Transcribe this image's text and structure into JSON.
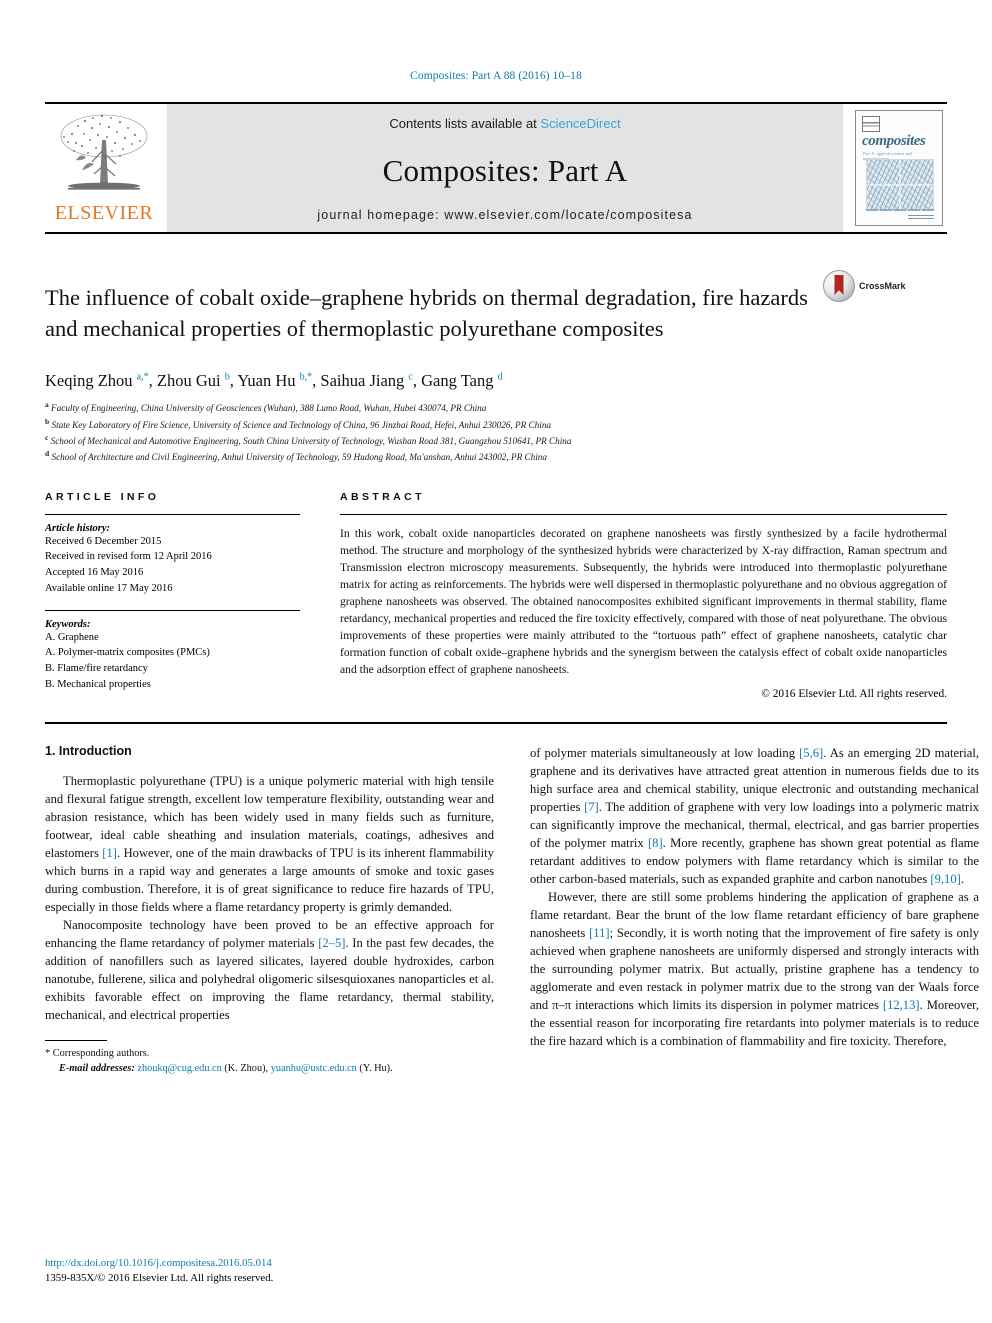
{
  "running_head": "Composites: Part A 88 (2016) 10–18",
  "masthead": {
    "publisher": "ELSEVIER",
    "contents_prefix": "Contents lists available at ",
    "contents_link": "ScienceDirect",
    "journal_name": "Composites: Part A",
    "homepage": "journal homepage: www.elsevier.com/locate/compositesa",
    "cover": {
      "title": "composites",
      "subtitle": "Part A: applied science and manufacturing"
    }
  },
  "article": {
    "title": "The influence of cobalt oxide–graphene hybrids on thermal degradation, fire hazards and mechanical properties of thermoplastic polyurethane composites",
    "crossmark_label": "CrossMark",
    "authors_html": "Keqing Zhou <sup>a,*</sup>, Zhou Gui <sup>b</sup>, Yuan Hu <sup>b,*</sup>, Saihua Jiang <sup>c</sup>, Gang Tang <sup>d</sup>",
    "affiliations": [
      {
        "marker": "a",
        "text": "Faculty of Engineering, China University of Geosciences (Wuhan), 388 Lumo Road, Wuhan, Hubei 430074, PR China"
      },
      {
        "marker": "b",
        "text": "State Key Laboratory of Fire Science, University of Science and Technology of China, 96 Jinzhai Road, Hefei, Anhui 230026, PR China"
      },
      {
        "marker": "c",
        "text": "School of Mechanical and Automotive Engineering, South China University of Technology, Wushan Road 381, Guangzhou 510641, PR China"
      },
      {
        "marker": "d",
        "text": "School of Architecture and Civil Engineering, Anhui University of Technology, 59 Hudong Road, Ma'anshan, Anhui 243002, PR China"
      }
    ]
  },
  "article_info": {
    "heading": "ARTICLE INFO",
    "history_title": "Article history:",
    "history": [
      "Received 6 December 2015",
      "Received in revised form 12 April 2016",
      "Accepted 16 May 2016",
      "Available online 17 May 2016"
    ],
    "keywords_title": "Keywords:",
    "keywords": [
      "A. Graphene",
      "A. Polymer-matrix composites (PMCs)",
      "B. Flame/fire retardancy",
      "B. Mechanical properties"
    ]
  },
  "abstract": {
    "heading": "ABSTRACT",
    "text": "In this work, cobalt oxide nanoparticles decorated on graphene nanosheets was firstly synthesized by a facile hydrothermal method. The structure and morphology of the synthesized hybrids were characterized by X-ray diffraction, Raman spectrum and Transmission electron microscopy measurements. Subsequently, the hybrids were introduced into thermoplastic polyurethane matrix for acting as reinforcements. The hybrids were well dispersed in thermoplastic polyurethane and no obvious aggregation of graphene nanosheets was observed. The obtained nanocomposites exhibited significant improvements in thermal stability, flame retardancy, mechanical properties and reduced the fire toxicity effectively, compared with those of neat polyurethane. The obvious improvements of these properties were mainly attributed to the “tortuous path” effect of graphene nanosheets, catalytic char formation function of cobalt oxide–graphene hybrids and the synergism between the catalysis effect of cobalt oxide nanoparticles and the adsorption effect of graphene nanosheets.",
    "copyright": "© 2016 Elsevier Ltd. All rights reserved."
  },
  "introduction": {
    "heading": "1. Introduction",
    "left_paragraphs_html": [
      "Thermoplastic polyurethane (TPU) is a unique polymeric material with high tensile and flexural fatigue strength, excellent low temperature flexibility, outstanding wear and abrasion resistance, which has been widely used in many fields such as furniture, footwear, ideal cable sheathing and insulation materials, coatings, adhesives and elastomers <span class=\"ref\">[1]</span>. However, one of the main drawbacks of TPU is its inherent flammability which burns in a rapid way and generates a large amounts of smoke and toxic gases during combustion. Therefore, it is of great significance to reduce fire hazards of TPU, especially in those fields where a flame retardancy property is grimly demanded.",
      "Nanocomposite technology have been proved to be an effective approach for enhancing the flame retardancy of polymer materials <span class=\"ref\">[2–5]</span>. In the past few decades, the addition of nanofillers such as layered silicates, layered double hydroxides, carbon nanotube, fullerene, silica and polyhedral oligomeric silsesquioxanes nanoparticles et al. exhibits favorable effect on improving the flame retardancy, thermal stability, mechanical, and electrical properties"
    ],
    "right_paragraphs_html": [
      "of polymer materials simultaneously at low loading <span class=\"ref\">[5,6]</span>. As an emerging 2D material, graphene and its derivatives have attracted great attention in numerous fields due to its high surface area and chemical stability, unique electronic and outstanding mechanical properties <span class=\"ref\">[7]</span>. The addition of graphene with very low loadings into a polymeric matrix can significantly improve the mechanical, thermal, electrical, and gas barrier properties of the polymer matrix <span class=\"ref\">[8]</span>. More recently, graphene has shown great potential as flame retardant additives to endow polymers with flame retardancy which is similar to the other carbon-based materials, such as expanded graphite and carbon nanotubes <span class=\"ref\">[9,10]</span>.",
      "However, there are still some problems hindering the application of graphene as a flame retardant. Bear the brunt of the low flame retardant efficiency of bare graphene nanosheets <span class=\"ref\">[11]</span>; Secondly, it is worth noting that the improvement of fire safety is only achieved when graphene nanosheets are uniformly dispersed and strongly interacts with the surrounding polymer matrix. But actually, pristine graphene has a tendency to agglomerate and even restack in polymer matrix due to the strong van der Waals force and π–π interactions which limits its dispersion in polymer matrices <span class=\"ref\">[12,13]</span>. Moreover, the essential reason for incorporating fire retardants into polymer materials is to reduce the fire hazard which is a combination of flammability and fire toxicity. Therefore,"
    ]
  },
  "footnotes": {
    "corresponding": "* Corresponding authors.",
    "email_label": "E-mail addresses:",
    "email_1": "zhoukq@cug.edu.cn",
    "email_1_owner": "(K. Zhou),",
    "email_2": "yuanhu@ustc.edu.cn",
    "email_2_owner": "(Y. Hu)."
  },
  "footer": {
    "doi": "http://dx.doi.org/10.1016/j.compositesa.2016.05.014",
    "issn_line": "1359-835X/© 2016 Elsevier Ltd. All rights reserved."
  }
}
